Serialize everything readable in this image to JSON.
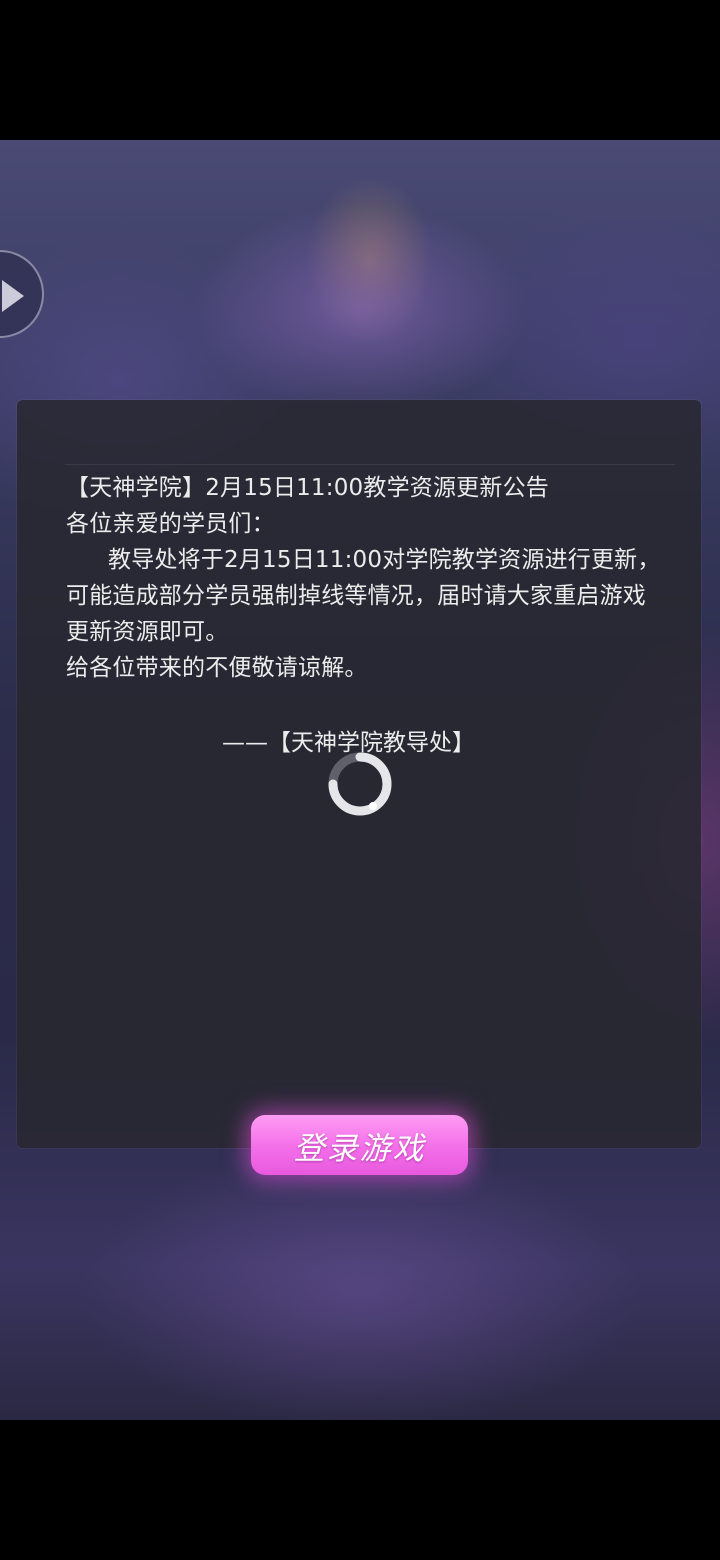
{
  "notice": {
    "title": "【天神学院】2月15日11:00教学资源更新公告",
    "greeting": "各位亲爱的学员们：",
    "body": "教导处将于2月15日11:00对学院教学资源进行更新，可能造成部分学员强制掉线等情况，届时请大家重启游戏更新资源即可。",
    "apology": "给各位带来的不便敬请谅解。",
    "signature": "——【天神学院教导处】"
  },
  "login": {
    "label": "登录游戏"
  },
  "icons": {
    "play": "play-icon",
    "loading": "loading-spinner-icon"
  },
  "colors": {
    "button_pink": "#f36ee8",
    "panel": "#28282f",
    "text": "#ececec"
  }
}
